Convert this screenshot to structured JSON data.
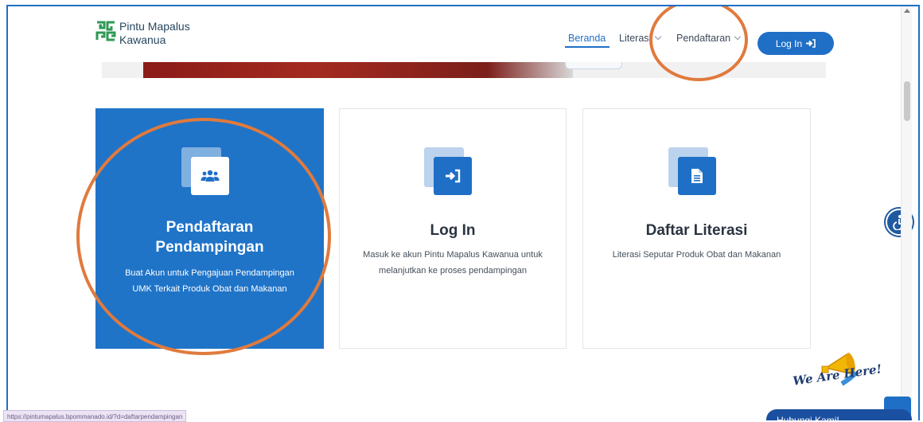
{
  "brand": {
    "line1": "Pintu Mapalus",
    "line2": "Kawanua"
  },
  "nav": {
    "items": [
      {
        "label": "Beranda",
        "active": true
      },
      {
        "label": "Literasi",
        "has_dropdown": true
      },
      {
        "label": "Pendaftaran",
        "has_dropdown": true
      }
    ],
    "login_label": "Log In"
  },
  "cards": [
    {
      "icon": "users-icon",
      "title_line1": "Pendaftaran",
      "title_line2": "Pendampingan",
      "desc_line1": "Buat Akun untuk Pengajuan Pendampingan",
      "desc_line2": "UMK Terkait Produk Obat dan Makanan"
    },
    {
      "icon": "sign-in-icon",
      "title": "Log In",
      "desc_line1": "Masuk ke akun Pintu Mapalus Kawanua untuk",
      "desc_line2": "melanjutkan ke proses pendampingan"
    },
    {
      "icon": "document-icon",
      "title": "Daftar Literasi",
      "desc_line1": "Literasi Seputar Produk Obat dan Makanan"
    }
  ],
  "widget": {
    "badge_text": "We Are Here!",
    "chat_label": "Hubungi Kami!"
  },
  "status_url": "https://pintumapalus.bpommanado.id/?d=daftarpendampingan",
  "colors": {
    "primary": "#1f6fc6",
    "annotation": "#e07a3d"
  }
}
